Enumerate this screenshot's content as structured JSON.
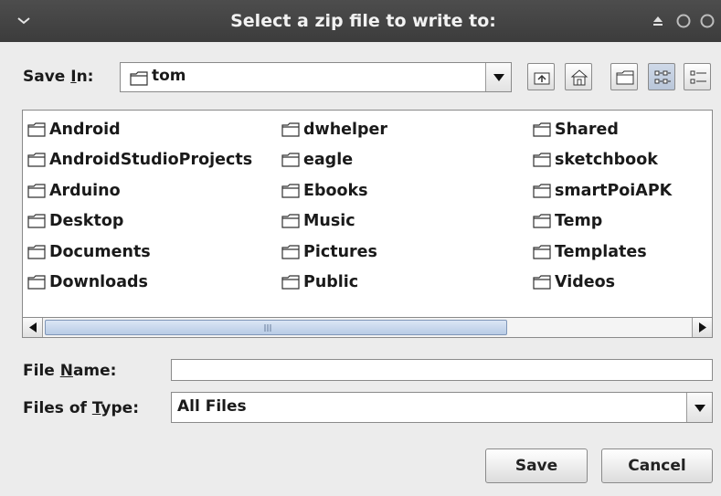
{
  "window": {
    "title": "Select a zip file to write to:"
  },
  "save_in": {
    "label_prefix": "Save ",
    "label_mnemonic": "I",
    "label_suffix": "n:",
    "value": "tom"
  },
  "toolbar": [
    "up-one-level-icon",
    "home-icon",
    "new-folder-icon",
    "list-view-icon",
    "details-view-icon"
  ],
  "files": {
    "columns": [
      [
        "Android",
        "AndroidStudioProjects",
        "Arduino",
        "Desktop",
        "Documents",
        "Downloads"
      ],
      [
        "dwhelper",
        "eagle",
        "Ebooks",
        "Music",
        "Pictures",
        "Public"
      ],
      [
        "Shared",
        "sketchbook",
        "smartPoiAPK",
        "Temp",
        "Templates",
        "Videos"
      ]
    ]
  },
  "file_name": {
    "label_prefix": "File ",
    "label_mnemonic": "N",
    "label_suffix": "ame:",
    "value": ""
  },
  "files_of_type": {
    "label_prefix": "Files of ",
    "label_mnemonic": "T",
    "label_suffix": "ype:",
    "value": "All Files"
  },
  "buttons": {
    "save": "Save",
    "cancel": "Cancel"
  }
}
